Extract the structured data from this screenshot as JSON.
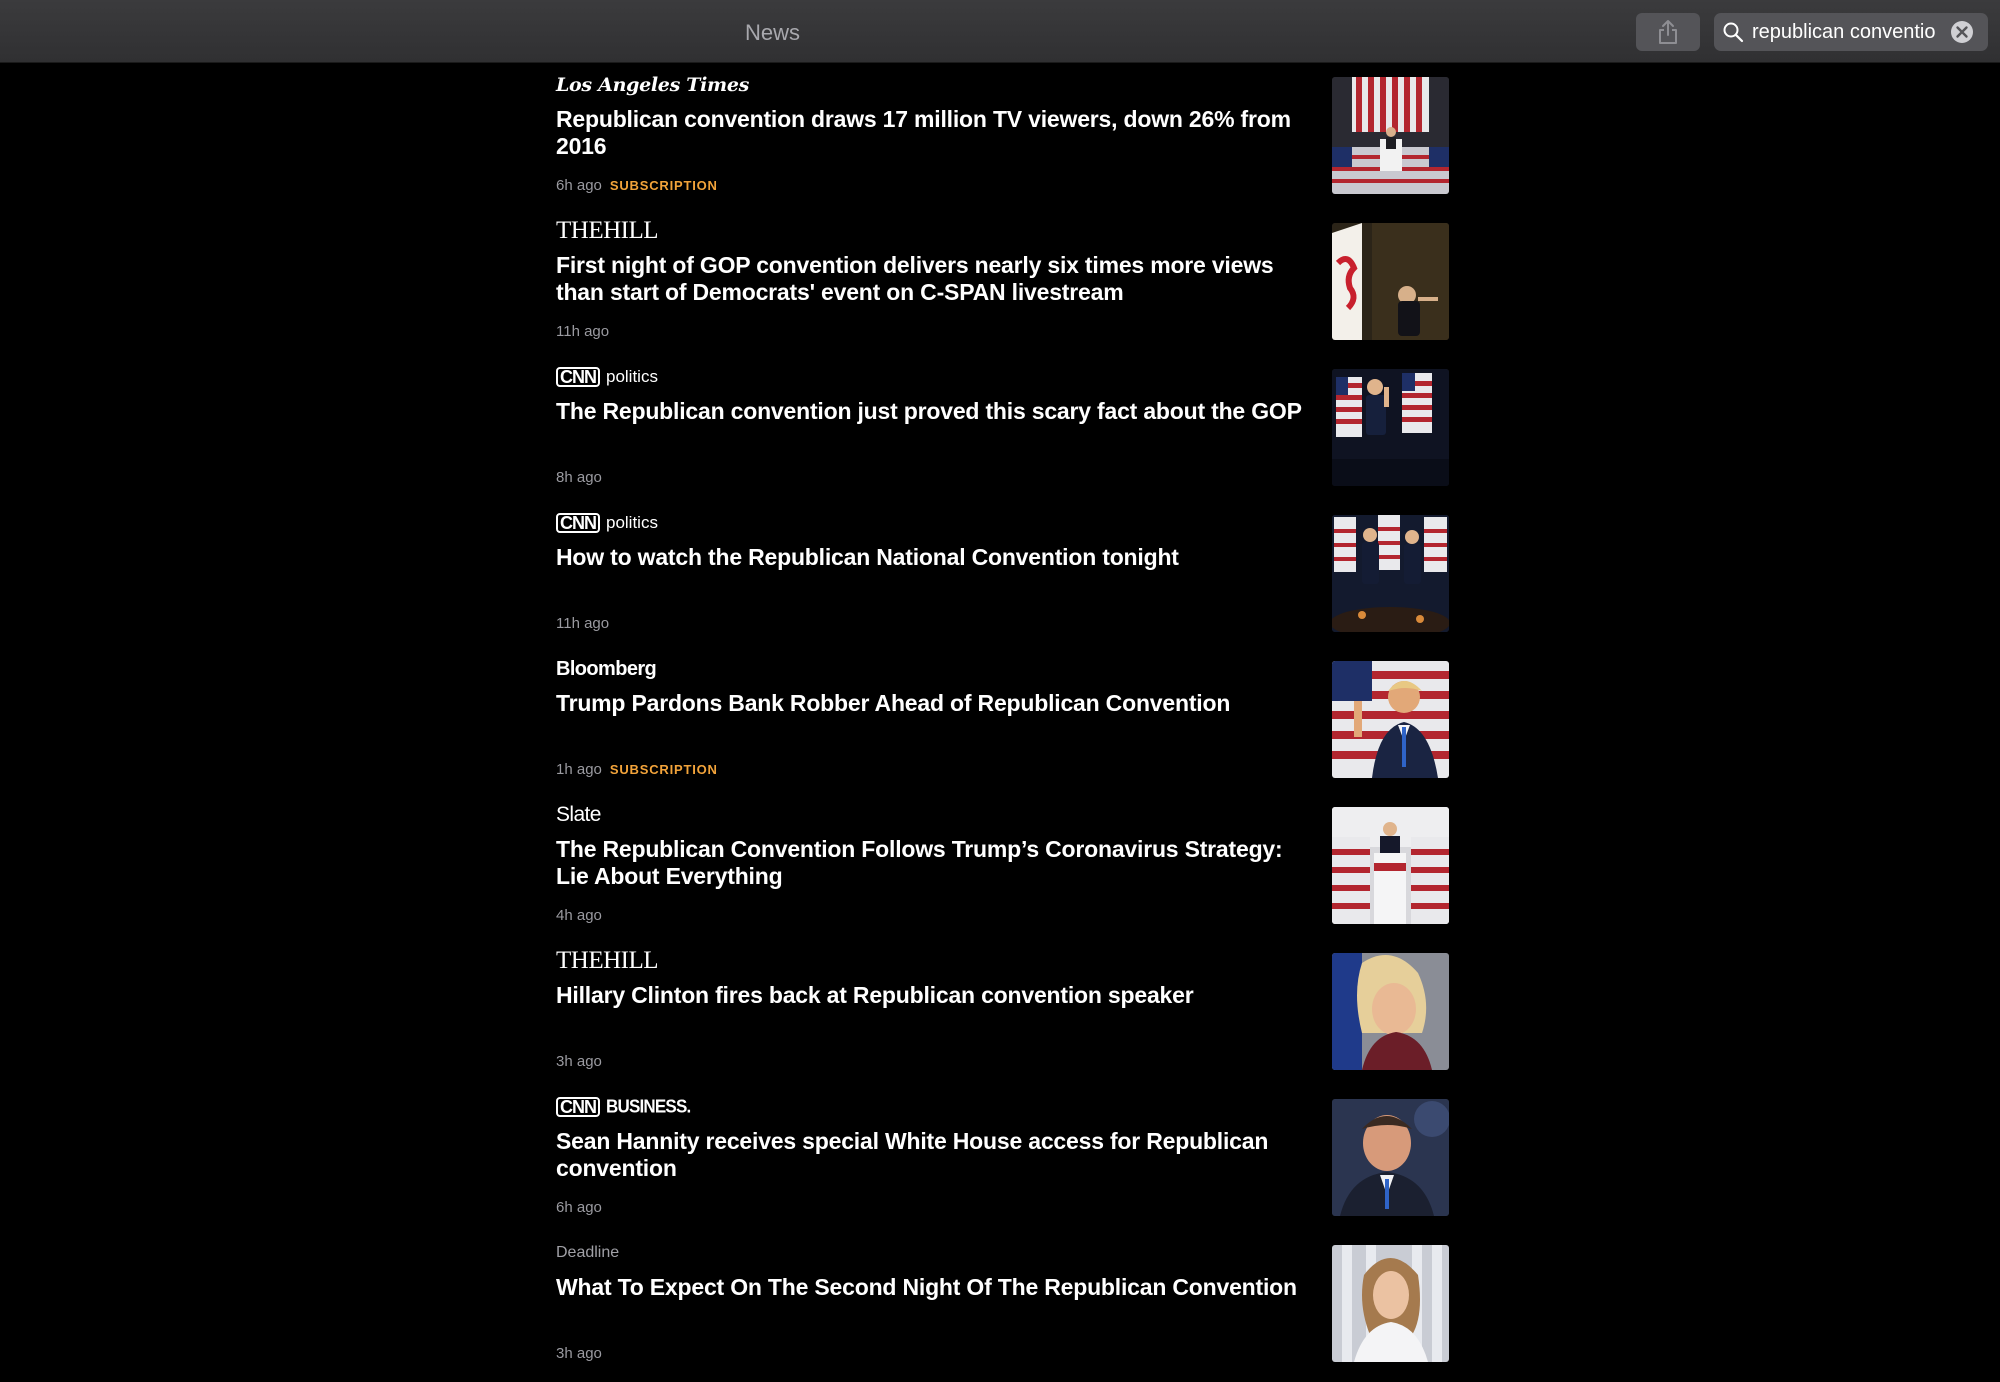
{
  "window": {
    "title": "News"
  },
  "search": {
    "query": "republican conventio",
    "placeholder": "Search"
  },
  "icons": {
    "share": "share-icon",
    "search": "magnifying-glass-icon",
    "clear": "clear-x-icon"
  },
  "colors": {
    "accent": "#f2a33a",
    "background": "#000000",
    "toolbar": "#333335"
  },
  "articles": [
    {
      "source": "Los Angeles Times",
      "headline": "Republican convention draws 17 million TV viewers, down 26% from 2016",
      "time": "6h ago",
      "badge": "SUBSCRIPTION"
    },
    {
      "source": "THEHILL",
      "headline": "First night of GOP convention delivers nearly six times more views than start of Democrats' event on C-SPAN livestream",
      "time": "11h ago"
    },
    {
      "source": "CNN",
      "source_sub": "politics",
      "headline": "The Republican convention just proved this scary fact about the GOP",
      "time": "8h ago"
    },
    {
      "source": "CNN",
      "source_sub": "politics",
      "headline": "How to watch the Republican National Convention tonight",
      "time": "11h ago"
    },
    {
      "source": "Bloomberg",
      "headline": "Trump Pardons Bank Robber Ahead of Republican Convention",
      "time": "1h ago",
      "badge": "SUBSCRIPTION"
    },
    {
      "source": "Slate",
      "headline": "The Republican Convention Follows Trump’s Coronavirus Strategy: Lie About Everything",
      "time": "4h ago"
    },
    {
      "source": "THEHILL",
      "headline": "Hillary Clinton fires back at Republican convention speaker",
      "time": "3h ago"
    },
    {
      "source": "CNN",
      "source_sub": "BUSINESS.",
      "headline": "Sean Hannity receives special White House access for Republican convention",
      "time": "6h ago"
    },
    {
      "source": "Deadline",
      "headline": "What To Expect On The Second Night Of The Republican Convention",
      "time": "3h ago"
    }
  ]
}
